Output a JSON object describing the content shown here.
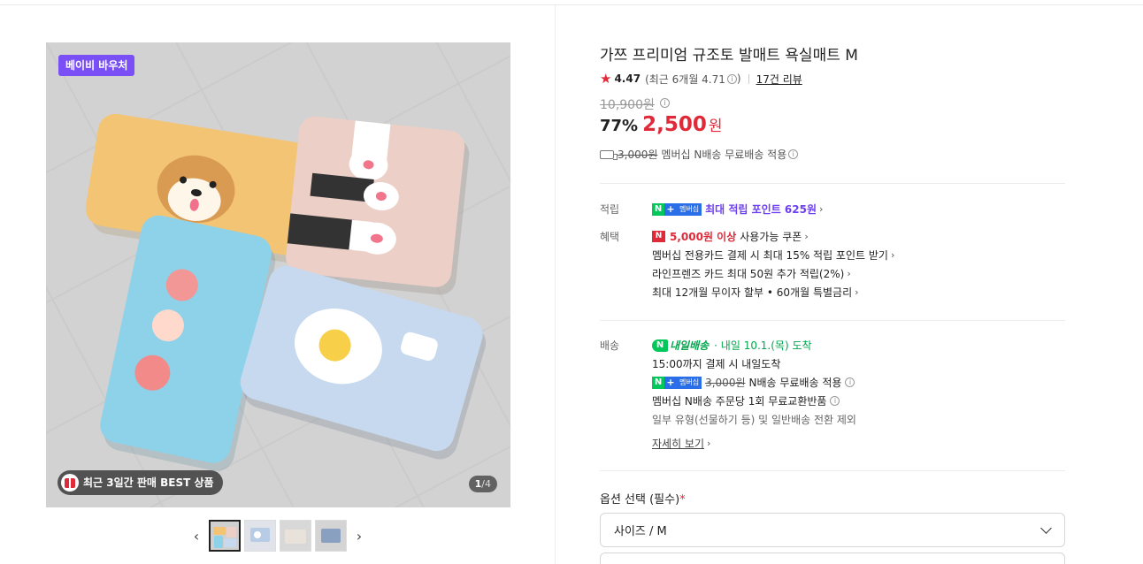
{
  "gallery": {
    "voucher_badge": "베이비 바우처",
    "best_badge": "최근 3일간 판매 BEST 상품",
    "page_current": "1",
    "page_total": "/4",
    "prev_icon": "chevron-left-icon",
    "next_icon": "chevron-right-icon",
    "thumbnails": 4,
    "active_thumbnail": 1
  },
  "product": {
    "title": "가쯔 프리미엄 규조토 발매트 욕실매트 M",
    "rating": "4.47",
    "rating_recent": "(최근 6개월 4.71",
    "rating_recent_close": ")",
    "review_link": "17건 리뷰",
    "original_price": "10,900원",
    "discount": "77%",
    "price": "2,500",
    "price_unit": "원",
    "shipping_orig": "3,000원",
    "shipping_text": "멤버십 N배송 무료배송 적용"
  },
  "points": {
    "label": "적립",
    "badge_n": "N",
    "badge_plus": "+",
    "badge_mem": "멤버십",
    "text": "최대 적립 포인트 625원"
  },
  "benefits": {
    "label": "혜택",
    "coupon_n": "N",
    "coupon_amount": "5,000원 이상",
    "coupon_text": "사용가능 쿠폰",
    "card1": "멤버십 전용카드 결제 시 최대 15% 적립 포인트 받기",
    "card2": "라인프렌즈 카드 최대 50원 추가 적립(2%)",
    "installment": "최대 12개월 무이자 할부 • 60개월 특별금리"
  },
  "delivery": {
    "label": "배송",
    "tomorrow_n": "N",
    "tomorrow": "내일배송",
    "arrive": "· 내일 10.1.(목) 도착",
    "cutoff": "15:00까지 결제 시 내일도착",
    "ship_orig": "3,000원",
    "ship_free": "N배송 무료배송 적용",
    "exchange": "멤버십 N배송 주문당 1회 무료교환반품",
    "exclude": "일부 유형(선물하기 등) 및 일반배송 전환 제외",
    "detail_link": "자세히 보기"
  },
  "options": {
    "label": "옵션 선택 (필수)",
    "required_mark": "*",
    "selected": "사이즈 / M"
  },
  "colors": {
    "accent_red": "#e02a3a",
    "naver_green": "#03c75a",
    "voucher_purple": "#7a4ff5",
    "point_purple": "#6d3ff0"
  }
}
